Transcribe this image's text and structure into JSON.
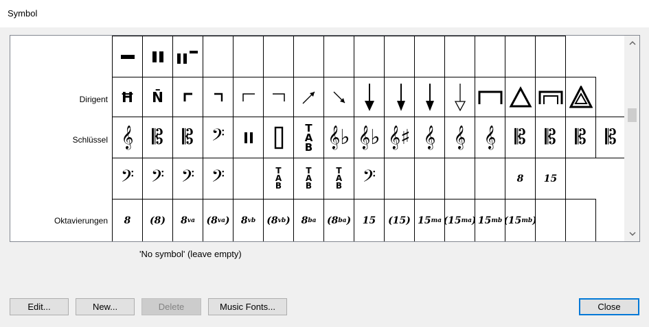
{
  "window": {
    "title": "Symbol"
  },
  "rows": [
    {
      "label": "",
      "cells": [
        {
          "kind": "svg",
          "icon": "whole-rest-icon",
          "svg": "wholerest"
        },
        {
          "kind": "svg",
          "icon": "double-bar-rest-icon",
          "svg": "dbl"
        },
        {
          "kind": "svg",
          "icon": "multi-rest-icon",
          "svg": "multirest"
        },
        {
          "kind": "empty"
        },
        {
          "kind": "empty"
        },
        {
          "kind": "empty"
        },
        {
          "kind": "empty"
        },
        {
          "kind": "empty"
        },
        {
          "kind": "empty"
        },
        {
          "kind": "empty"
        },
        {
          "kind": "empty"
        },
        {
          "kind": "empty"
        },
        {
          "kind": "empty"
        },
        {
          "kind": "empty"
        },
        {
          "kind": "empty"
        }
      ]
    },
    {
      "label": "Dirigent",
      "cells": [
        {
          "kind": "text",
          "text": "Ħ",
          "cls": "t-bold",
          "icon": "conductor-h-icon"
        },
        {
          "kind": "text",
          "text": "N̄",
          "cls": "t-bold",
          "icon": "conductor-n-icon"
        },
        {
          "kind": "svg",
          "icon": "corner-bracket-left-bold-icon",
          "svg": "cornerL_b"
        },
        {
          "kind": "svg",
          "icon": "corner-bracket-right-bold-icon",
          "svg": "cornerR_b"
        },
        {
          "kind": "svg",
          "icon": "corner-bracket-left-icon",
          "svg": "cornerL"
        },
        {
          "kind": "svg",
          "icon": "corner-bracket-right-icon",
          "svg": "cornerR"
        },
        {
          "kind": "svg",
          "icon": "arrow-up-right-icon",
          "svg": "arrowUR"
        },
        {
          "kind": "svg",
          "icon": "arrow-down-right-icon",
          "svg": "arrowDR"
        },
        {
          "kind": "svg",
          "icon": "arrow-down-icon",
          "svg": "arrowD1"
        },
        {
          "kind": "svg",
          "icon": "arrow-down-icon",
          "svg": "arrowD2"
        },
        {
          "kind": "svg",
          "icon": "arrow-down-icon",
          "svg": "arrowD3"
        },
        {
          "kind": "svg",
          "icon": "arrow-down-hollow-icon",
          "svg": "arrowDH"
        },
        {
          "kind": "svg",
          "icon": "fermata-square-icon",
          "svg": "square"
        },
        {
          "kind": "svg",
          "icon": "triangle-icon",
          "svg": "triangle"
        },
        {
          "kind": "svg",
          "icon": "fermata-double-square-icon",
          "svg": "square2"
        },
        {
          "kind": "svg",
          "icon": "double-triangle-icon",
          "svg": "triangle2"
        }
      ]
    },
    {
      "label": "Schlüssel",
      "cells": [
        {
          "kind": "text",
          "text": "𝄞",
          "cls": "t-clef",
          "icon": "treble-clef-icon"
        },
        {
          "kind": "text",
          "text": "𝄡",
          "cls": "t-clef",
          "icon": "alto-clef-icon"
        },
        {
          "kind": "text",
          "text": "𝄡",
          "cls": "t-clef",
          "icon": "tenor-clef-icon"
        },
        {
          "kind": "text",
          "text": "𝄢",
          "cls": "t-clef",
          "icon": "bass-clef-icon"
        },
        {
          "kind": "svg",
          "icon": "percussion-clef-icon",
          "svg": "perc"
        },
        {
          "kind": "svg",
          "icon": "percussion-box-clef-icon",
          "svg": "percbox"
        },
        {
          "kind": "text",
          "text": "T\nA\nB",
          "cls": "t-tab-lg",
          "icon": "tab-clef-icon"
        },
        {
          "kind": "text",
          "text": "𝄞♭",
          "cls": "t-clef",
          "icon": "treble-clef-flat-icon"
        },
        {
          "kind": "text",
          "text": "𝄞♭",
          "cls": "t-clef",
          "icon": "treble-clef-flat-icon"
        },
        {
          "kind": "text",
          "text": "𝄞♯",
          "cls": "t-clef",
          "icon": "treble-clef-sharp-icon"
        },
        {
          "kind": "text",
          "text": "𝄞",
          "cls": "t-clef",
          "icon": "treble-clef-icon"
        },
        {
          "kind": "text",
          "text": "𝄞",
          "cls": "t-clef",
          "icon": "treble-clef-icon"
        },
        {
          "kind": "text",
          "text": "𝄞",
          "cls": "t-clef",
          "icon": "treble-clef-icon"
        },
        {
          "kind": "text",
          "text": "𝄡",
          "cls": "t-clef",
          "icon": "c-clef-icon"
        },
        {
          "kind": "text",
          "text": "𝄡",
          "cls": "t-clef",
          "icon": "c-clef-icon"
        },
        {
          "kind": "text",
          "text": "𝄡",
          "cls": "t-clef",
          "icon": "c-clef-8vb-icon"
        },
        {
          "kind": "text",
          "text": "𝄡",
          "cls": "t-clef",
          "icon": "c-clef-icon"
        }
      ]
    },
    {
      "label": "",
      "cells": [
        {
          "kind": "text",
          "text": "𝄢",
          "cls": "t-clef",
          "icon": "bass-clef-8va-icon"
        },
        {
          "kind": "text",
          "text": "𝄢",
          "cls": "t-clef",
          "icon": "bass-clef-8vb-icon"
        },
        {
          "kind": "text",
          "text": "𝄢",
          "cls": "t-clef",
          "icon": "bass-clef-15ma-icon"
        },
        {
          "kind": "text",
          "text": "𝄢",
          "cls": "t-clef",
          "icon": "bass-clef-icon"
        },
        {
          "kind": "empty"
        },
        {
          "kind": "text",
          "text": "T\nA\nB",
          "cls": "t-tab",
          "icon": "tab-clef-icon"
        },
        {
          "kind": "text",
          "text": "T\nA\nB",
          "cls": "t-tab",
          "icon": "tab-clef-icon"
        },
        {
          "kind": "text",
          "text": "T\nA\nB",
          "cls": "t-tab",
          "icon": "tab-clef-icon"
        },
        {
          "kind": "text",
          "text": "𝄢",
          "cls": "t-clef",
          "icon": "bass-clef-icon"
        },
        {
          "kind": "empty"
        },
        {
          "kind": "empty"
        },
        {
          "kind": "empty"
        },
        {
          "kind": "empty"
        },
        {
          "kind": "text",
          "text": "8",
          "cls": "t-oct",
          "icon": "octave-8-icon"
        },
        {
          "kind": "text",
          "text": "15",
          "cls": "t-oct",
          "icon": "octave-15-icon"
        }
      ]
    },
    {
      "label": "Oktavierungen",
      "cells": [
        {
          "kind": "text",
          "text": "8",
          "cls": "t-oct",
          "icon": "octave-8-icon"
        },
        {
          "kind": "text",
          "text": "(8)",
          "cls": "t-oct",
          "icon": "octave-8-paren-icon"
        },
        {
          "kind": "oct",
          "base": "8",
          "sup": "va",
          "paren": false,
          "icon": "ottava-alta-icon"
        },
        {
          "kind": "oct",
          "base": "8",
          "sup": "va",
          "paren": true,
          "icon": "ottava-alta-paren-icon"
        },
        {
          "kind": "oct",
          "base": "8",
          "sup": "vb",
          "paren": false,
          "icon": "ottava-bassa-icon"
        },
        {
          "kind": "oct",
          "base": "8",
          "sup": "vb",
          "paren": true,
          "icon": "ottava-bassa-paren-icon"
        },
        {
          "kind": "oct",
          "base": "8",
          "sup": "ba",
          "paren": false,
          "icon": "ottava-ba-icon"
        },
        {
          "kind": "oct",
          "base": "8",
          "sup": "ba",
          "paren": true,
          "icon": "ottava-ba-paren-icon"
        },
        {
          "kind": "text",
          "text": "15",
          "cls": "t-oct",
          "icon": "quindicesima-icon"
        },
        {
          "kind": "text",
          "text": "(15)",
          "cls": "t-oct",
          "icon": "quindicesima-paren-icon"
        },
        {
          "kind": "oct",
          "base": "15",
          "sup": "ma",
          "paren": false,
          "icon": "quindicesima-alta-icon"
        },
        {
          "kind": "oct",
          "base": "15",
          "sup": "ma",
          "paren": true,
          "icon": "quindicesima-alta-paren-icon"
        },
        {
          "kind": "oct",
          "base": "15",
          "sup": "mb",
          "paren": false,
          "icon": "quindicesima-bassa-icon"
        },
        {
          "kind": "oct",
          "base": "15",
          "sup": "mb",
          "paren": true,
          "icon": "quindicesima-bassa-paren-icon"
        },
        {
          "kind": "empty"
        },
        {
          "kind": "empty"
        }
      ]
    }
  ],
  "status": "'No symbol' (leave empty)",
  "buttons": {
    "edit": "Edit...",
    "new": "New...",
    "delete": "Delete",
    "music_fonts": "Music Fonts...",
    "close": "Close"
  },
  "colors": {
    "accent": "#0078d7",
    "panel_border": "#828790",
    "button_face": "#e1e1e1"
  }
}
